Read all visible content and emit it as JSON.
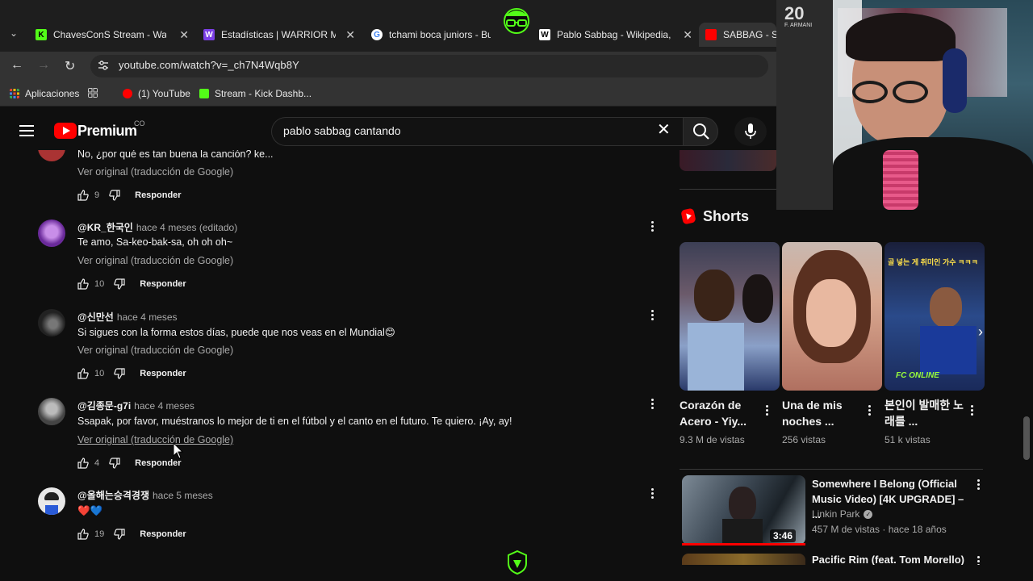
{
  "browser": {
    "tabs": [
      {
        "title": "ChavesConS Stream - Watch",
        "color": "#53fc18",
        "letter": "K"
      },
      {
        "title": "Estadísticas | WARRIOR Mex",
        "color": "#7b3fe4",
        "letter": "W"
      },
      {
        "title": "tchami boca juniors - Bu",
        "color": "#4285f4",
        "letter": "G"
      },
      {
        "title": "Pablo Sabbag - Wikipedia, la",
        "color": "#ffffff",
        "letter": "W"
      },
      {
        "title": "SABBAG - SE",
        "color": "#ff0000",
        "letter": ""
      }
    ],
    "url": "youtube.com/watch?v=_ch7N4Wqb8Y",
    "bookmarks": [
      {
        "label": "Aplicaciones"
      },
      {
        "label": "(1) YouTube"
      },
      {
        "label": "Stream - Kick Dashb..."
      }
    ]
  },
  "youtube": {
    "logo_text": "Premium",
    "country": "CO",
    "search_query": "pablo sabbag cantando"
  },
  "comments": [
    {
      "author": "",
      "time": "",
      "text": "No, ¿por qué es tan buena la canción? ke...",
      "translate": "Ver original (traducción de Google)",
      "likes": "9",
      "reply": "Responder",
      "avatar_color": "#a33"
    },
    {
      "author": "@KR_한국인",
      "time": "hace 4 meses (editado)",
      "text": "Te amo, Sa-keo-bak-sa, oh oh oh~",
      "translate": "Ver original (traducción de Google)",
      "likes": "10",
      "reply": "Responder",
      "avatar_color": "#6a2a9a"
    },
    {
      "author": "@신만선",
      "time": "hace 4 meses",
      "text": "Si sigues con la forma estos días, puede que nos veas en el Mundial😊",
      "translate": "Ver original (traducción de Google)",
      "likes": "10",
      "reply": "Responder",
      "avatar_color": "#2a2a2a"
    },
    {
      "author": "@김종문-g7i",
      "time": "hace 4 meses",
      "text": "Ssapak, por favor, muéstranos lo mejor de ti en el fútbol y el canto en el futuro. Te quiero. ¡Ay, ay!",
      "translate": "Ver original (traducción de Google)",
      "likes": "4",
      "reply": "Responder",
      "avatar_color": "#555"
    },
    {
      "author": "@올해는승격경쟁",
      "time": "hace 5 meses",
      "text": "❤️💙",
      "likes": "19",
      "reply": "Responder",
      "avatar_color": "#e8e8e8"
    }
  ],
  "sidebar": {
    "shorts_title": "Shorts",
    "shorts": [
      {
        "title": "Corazón de Acero - Yiy...",
        "views": "9.3 M de vistas"
      },
      {
        "title": "Una de mis noches ...",
        "views": "256 vistas"
      },
      {
        "title": "본인이 발매한 노래를 ...",
        "views": "51 k vistas",
        "thumb_caption": "골 넣는 게 취미인 가수 ㅋㅋㅋ",
        "thumb_badge": "FC ONLINE"
      }
    ],
    "videos": [
      {
        "title": "Somewhere I Belong (Official Music Video) [4K UPGRADE] – ...",
        "channel": "Linkin Park",
        "meta": "457 M de vistas · hace 18 años",
        "duration": "3:46"
      },
      {
        "title": "Pacific Rim (feat. Tom Morello)"
      }
    ]
  },
  "webcam": {
    "jersey_number": "20",
    "jersey_name": "F. ARMANI"
  }
}
